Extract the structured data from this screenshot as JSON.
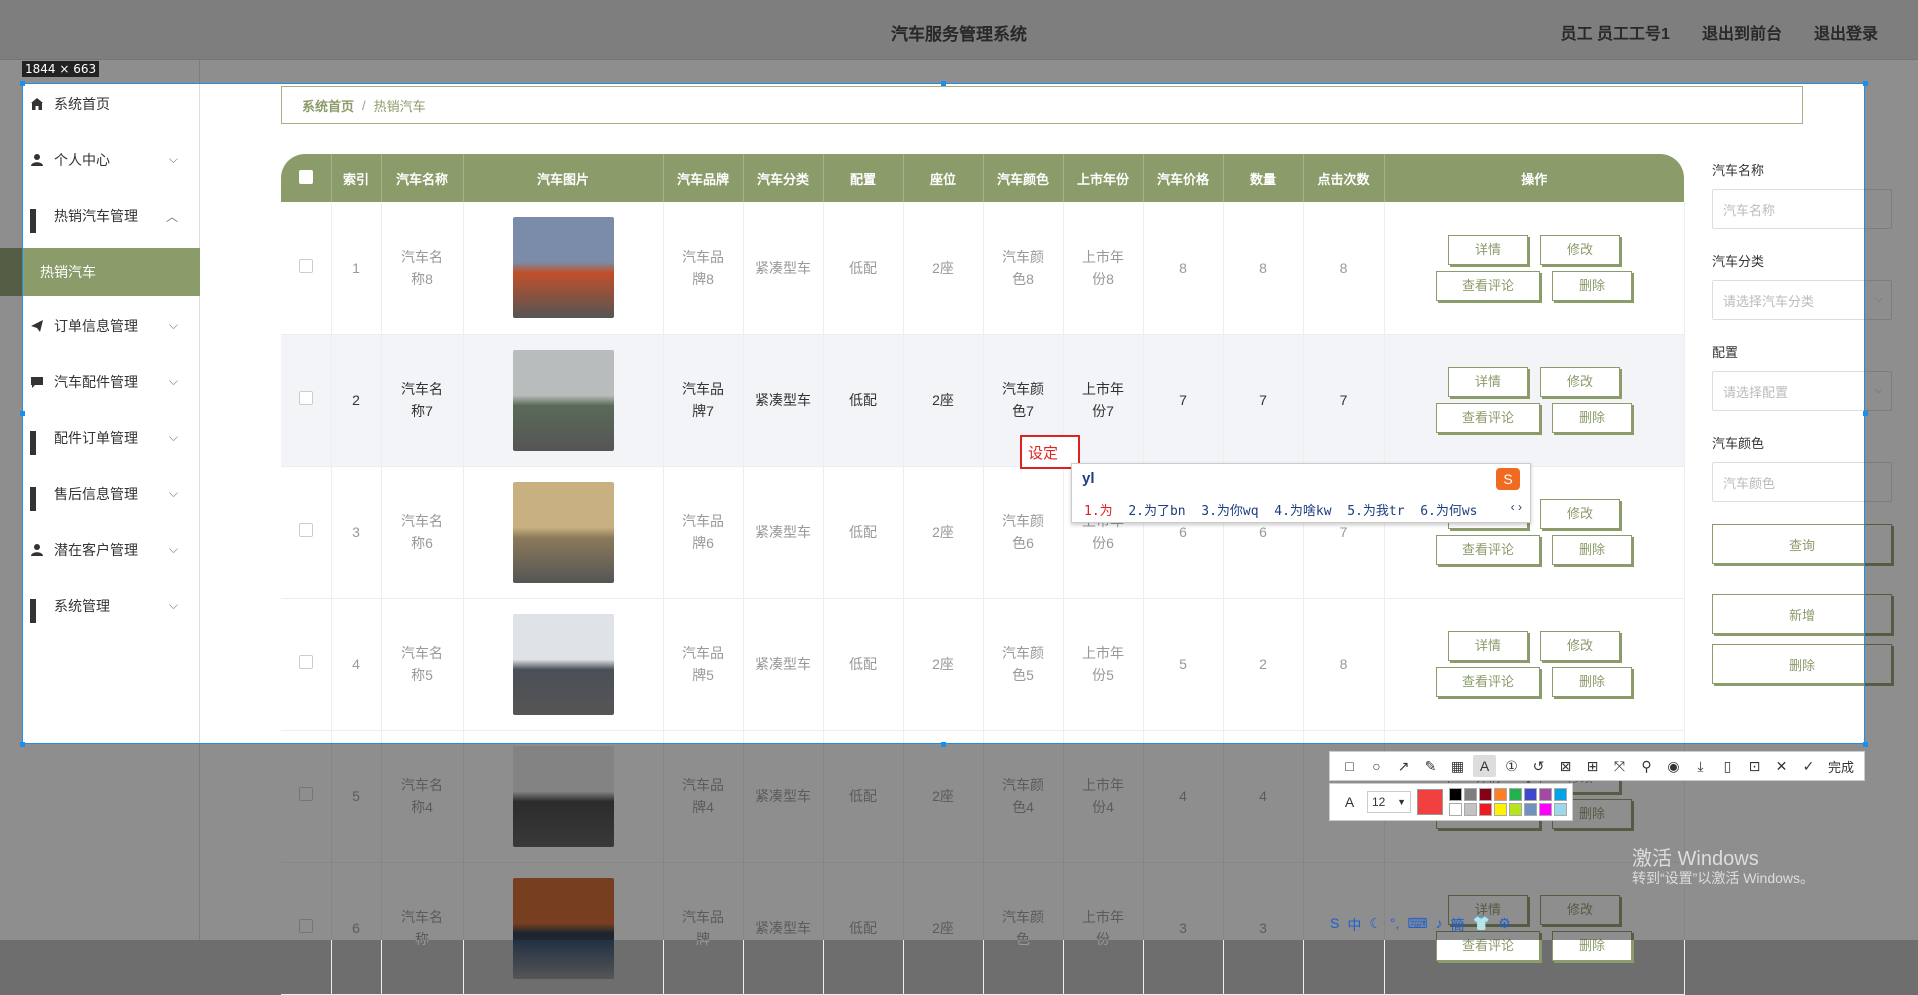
{
  "topbar": {
    "title": "汽车服务管理系统",
    "user": "员工 员工工号1",
    "front": "退出到前台",
    "logout": "退出登录"
  },
  "sidebar": {
    "items": [
      {
        "label": "系统首页",
        "icon": "home-icon"
      },
      {
        "label": "个人中心",
        "icon": "user-icon"
      },
      {
        "label": "热销汽车管理",
        "icon": "grid-icon"
      },
      {
        "label": "订单信息管理",
        "icon": "send-icon"
      },
      {
        "label": "汽车配件管理",
        "icon": "chat-icon"
      },
      {
        "label": "配件订单管理",
        "icon": "grid-icon"
      },
      {
        "label": "售后信息管理",
        "icon": "grid-icon"
      },
      {
        "label": "潜在客户管理",
        "icon": "user-icon"
      },
      {
        "label": "系统管理",
        "icon": "grid-icon"
      }
    ],
    "sub_active": "热销汽车"
  },
  "breadcrumb": {
    "home": "系统首页",
    "sep": "/",
    "current": "热销汽车"
  },
  "table": {
    "headers": [
      "索引",
      "汽车名称",
      "汽车图片",
      "汽车品牌",
      "汽车分类",
      "配置",
      "座位",
      "汽车颜色",
      "上市年份",
      "汽车价格",
      "数量",
      "点击次数",
      "操作"
    ],
    "rows": [
      {
        "idx": "1",
        "name": "汽车名称8",
        "brand": "汽车品牌8",
        "cat": "紧凑型车",
        "cfg": "低配",
        "seat": "2座",
        "color": "汽车颜色8",
        "year": "上市年份8",
        "price": "8",
        "qty": "8",
        "clicks": "8"
      },
      {
        "idx": "2",
        "name": "汽车名称7",
        "brand": "汽车品牌7",
        "cat": "紧凑型车",
        "cfg": "低配",
        "seat": "2座",
        "color": "汽车颜色7",
        "year": "上市年份7",
        "price": "7",
        "qty": "7",
        "clicks": "7"
      },
      {
        "idx": "3",
        "name": "汽车名称6",
        "brand": "汽车品牌6",
        "cat": "紧凑型车",
        "cfg": "低配",
        "seat": "2座",
        "color": "汽车颜色6",
        "year": "上市年份6",
        "price": "6",
        "qty": "6",
        "clicks": "7"
      },
      {
        "idx": "4",
        "name": "汽车名称5",
        "brand": "汽车品牌5",
        "cat": "紧凑型车",
        "cfg": "低配",
        "seat": "2座",
        "color": "汽车颜色5",
        "year": "上市年份5",
        "price": "5",
        "qty": "2",
        "clicks": "8"
      },
      {
        "idx": "5",
        "name": "汽车名称4",
        "brand": "汽车品牌4",
        "cat": "紧凑型车",
        "cfg": "低配",
        "seat": "2座",
        "color": "汽车颜色4",
        "year": "上市年份4",
        "price": "4",
        "qty": "4",
        "clicks": ""
      },
      {
        "idx": "6",
        "name": "汽车名称",
        "brand": "汽车品牌",
        "cat": "紧凑型车",
        "cfg": "低配",
        "seat": "2座",
        "color": "汽车颜色",
        "year": "上市年份",
        "price": "3",
        "qty": "3",
        "clicks": ""
      }
    ],
    "ops": {
      "detail": "详情",
      "edit": "修改",
      "comments": "查看评论",
      "delete": "删除"
    }
  },
  "filter": {
    "name_label": "汽车名称",
    "name_ph": "汽车名称",
    "cat_label": "汽车分类",
    "cat_ph": "请选择汽车分类",
    "cfg_label": "配置",
    "cfg_ph": "请选择配置",
    "color_label": "汽车颜色",
    "color_ph": "汽车颜色",
    "query": "查询",
    "add": "新增",
    "delete": "删除"
  },
  "overlay": {
    "size_tag": "1844 × 663",
    "ime_text": "设定",
    "ime_comp": "yl",
    "ime_cands": [
      "1.为",
      "2.为了bn",
      "3.为你wq",
      "4.为啥kw",
      "5.为我tr",
      "6.为何ws"
    ],
    "font_size": "12",
    "done": "完成",
    "watermark1": "激活 Windows",
    "watermark2": "转到“设置”以激活 Windows。"
  },
  "colors": {
    "accent": "#8b9b6a",
    "selection": "#1e8ee8",
    "ime_red": "#dd2222"
  }
}
